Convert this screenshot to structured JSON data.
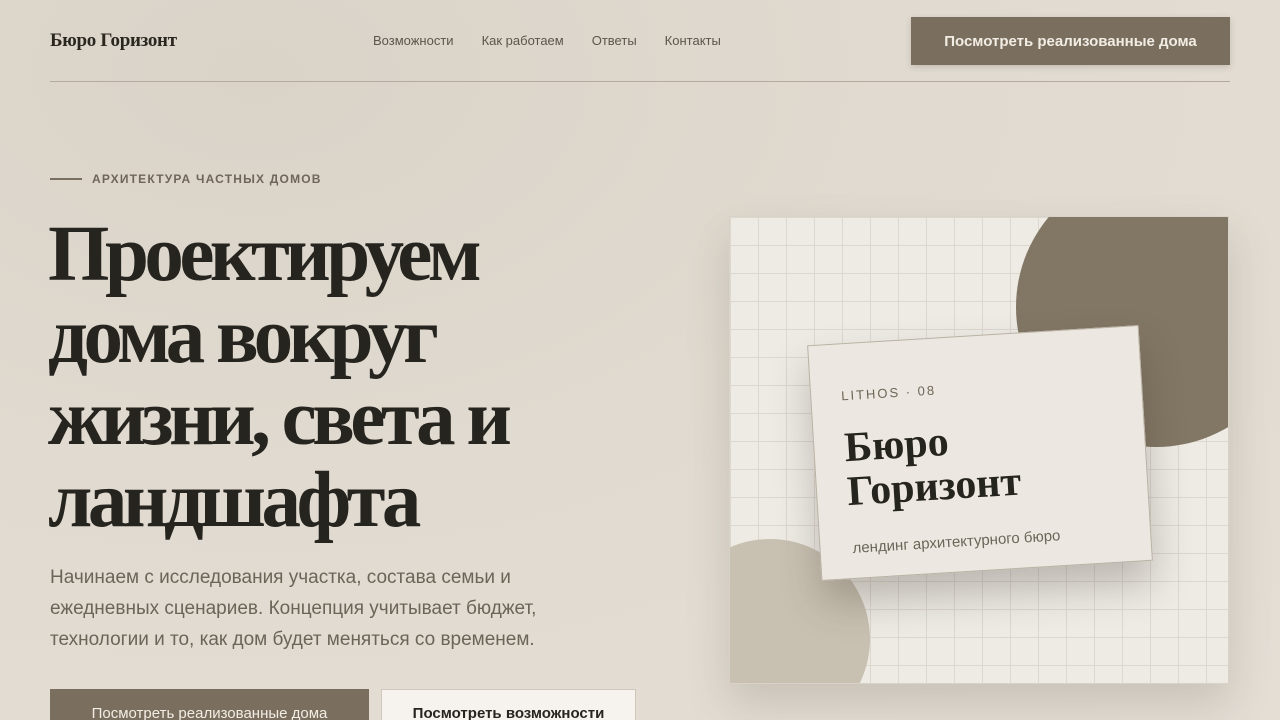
{
  "header": {
    "logo": "Бюро Горизонт",
    "nav": [
      "Возможности",
      "Как работаем",
      "Ответы",
      "Контакты"
    ],
    "cta_label": "Посмотреть реализованные дома"
  },
  "hero": {
    "eyebrow": "АРХИТЕКТУРА ЧАСТНЫХ ДОМОВ",
    "title_lines": [
      "Проектируем",
      "дома вокруг",
      "жизни, света и",
      "ландшафта"
    ],
    "lead": "Начинаем с исследования участка, состава семьи и ежедневных сценариев. Концепция учитывает бюджет, технологии и то, как дом будет меняться со временем.",
    "primary_button": "Посмотреть реализованные дома",
    "secondary_button": "Посмотреть возможности"
  },
  "card": {
    "tag": "LITHOS · 08",
    "title_lines": [
      "Бюро",
      "Горизонт"
    ],
    "subtitle": "лендинг архитектурного бюро"
  },
  "colors": {
    "accent": "#7a6f5e",
    "background": "#e0dad0",
    "text": "#26241e"
  }
}
